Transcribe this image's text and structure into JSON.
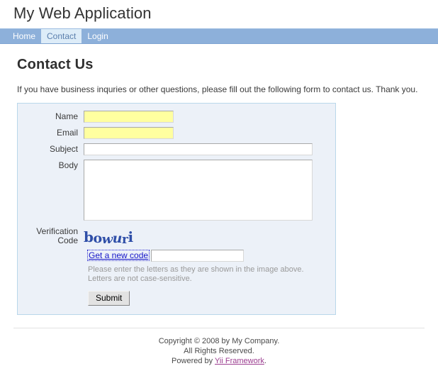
{
  "header": {
    "site_title": "My Web Application"
  },
  "nav": {
    "items": [
      {
        "label": "Home",
        "active": false
      },
      {
        "label": "Contact",
        "active": true
      },
      {
        "label": "Login",
        "active": false
      }
    ]
  },
  "page": {
    "title": "Contact Us",
    "intro": "If you have business inquries or other questions, please fill out the following form to contact us. Thank you."
  },
  "form": {
    "fields": {
      "name": {
        "label": "Name",
        "value": "",
        "placeholder": ""
      },
      "email": {
        "label": "Email",
        "value": "",
        "placeholder": ""
      },
      "subject": {
        "label": "Subject",
        "value": "",
        "placeholder": ""
      },
      "body": {
        "label": "Body",
        "value": "",
        "placeholder": ""
      },
      "verification": {
        "label_line1": "Verification",
        "label_line2": "Code",
        "value": "",
        "placeholder": ""
      }
    },
    "captcha": {
      "text": "bowuri",
      "chars": [
        "b",
        "o",
        "w",
        "u",
        "r",
        "i"
      ],
      "color": "#2f4fa8",
      "refresh_link": "Get a new code"
    },
    "hint_line1": "Please enter the letters as they are shown in the image above.",
    "hint_line2": "Letters are not case-sensitive.",
    "submit_label": "Submit",
    "required_field_color": "#ffffa0",
    "panel_background": "#ecf1f8",
    "panel_border": "#b9d7ea"
  },
  "footer": {
    "copyright": "Copyright © 2008 by My Company.",
    "rights": "All Rights Reserved.",
    "powered_prefix": "Powered by ",
    "powered_link": "Yii Framework",
    "powered_suffix": ".",
    "link_color": "#9b3c8f"
  },
  "theme": {
    "nav_background": "#8db0da",
    "nav_active_background": "#ddecf8",
    "nav_active_text": "#5b7fad",
    "link_blue": "#1616c9"
  }
}
